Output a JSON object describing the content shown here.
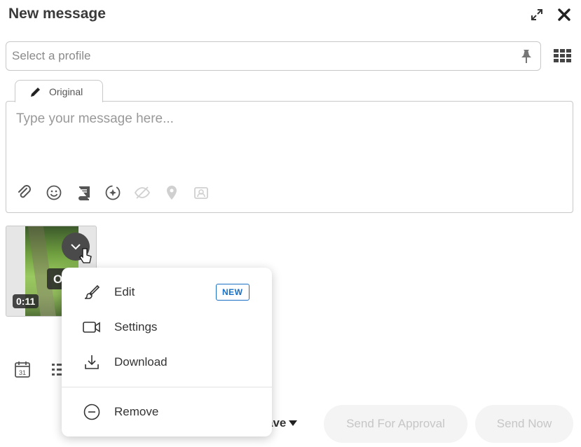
{
  "header": {
    "title": "New message",
    "expand_icon": "expand-arrows-icon",
    "close_icon": "close-x-icon"
  },
  "profile_select": {
    "placeholder": "Select a profile",
    "pin_icon": "pin-icon",
    "grid_icon": "grid-apps-icon"
  },
  "composer": {
    "tab_label": "Original",
    "placeholder": "Type your message here...",
    "tools": [
      "paperclip-icon",
      "emoji-icon",
      "book-icon",
      "ai-sparkle-icon",
      "eye-off-icon",
      "location-pin-icon",
      "contact-card-icon"
    ]
  },
  "media": {
    "duration": "0:11",
    "overlay_text": "O"
  },
  "dropdown": {
    "items": [
      {
        "label": "Edit",
        "icon": "paintbrush-icon",
        "badge": "NEW"
      },
      {
        "label": "Settings",
        "icon": "video-camera-icon"
      },
      {
        "label": "Download",
        "icon": "download-icon"
      },
      {
        "label": "Remove",
        "icon": "minus-circle-icon"
      }
    ]
  },
  "footer": {
    "calendar_day": "31",
    "save_label": "ave",
    "send_approval_label": "Send For Approval",
    "send_now_label": "Send Now"
  },
  "colors": {
    "accent_blue": "#1a6fc4",
    "disabled_text": "#c6c6c6",
    "disabled_bg": "#f4f4f4"
  }
}
